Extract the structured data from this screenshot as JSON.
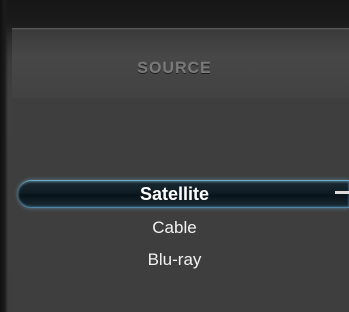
{
  "menu": {
    "title": "SOURCE",
    "items": [
      {
        "label": "Satellite",
        "selected": true
      },
      {
        "label": "Cable",
        "selected": false
      },
      {
        "label": "Blu-ray",
        "selected": false
      }
    ]
  },
  "colors": {
    "background": "#3e3e3e",
    "highlight": "#0f1c24",
    "highlight_glow": "#6fa8c9",
    "text": "#f2f2f2",
    "title": "#7a7a7a"
  },
  "icons": {
    "scroll_indicator": "arrow-indicator-icon"
  }
}
